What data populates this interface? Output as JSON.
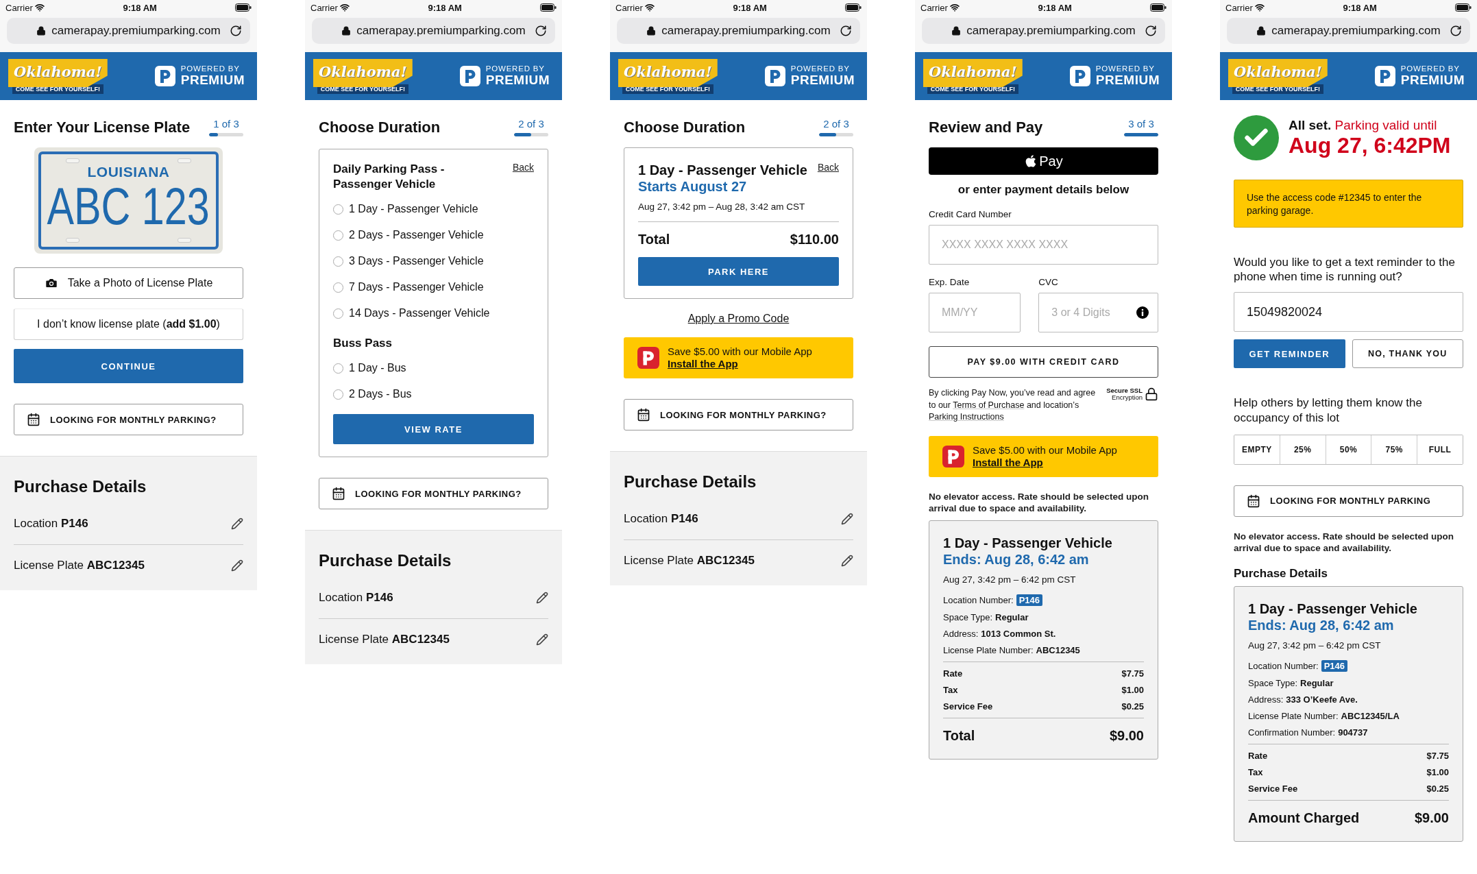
{
  "screens": [
    {
      "status_bar": {
        "carrier": "Carrier",
        "time": "9:18 AM"
      },
      "address_bar": {
        "url": "camerapay.premiumparking.com"
      },
      "header": {
        "logo_wordmark": "Oklahoma!",
        "logo_tagline": "COME SEE FOR YOURSELF!",
        "powered_by": "POWERED BY",
        "brand": "PREMIUM"
      },
      "blocks": [
        {
          "kind": "step_heading",
          "title": "Enter Your License Plate",
          "step": "1 of 3",
          "level": 0.25
        },
        {
          "kind": "plate",
          "state": "LOUISIANA",
          "number": "ABC 123"
        },
        {
          "kind": "photo_button",
          "label": "Take a Photo of License Plate"
        },
        {
          "kind": "text_button",
          "label": "I don’t know license plate (**add $1.00**)"
        },
        {
          "kind": "primary_button",
          "label": "CONTINUE"
        },
        {
          "kind": "monthly_button",
          "label": "LOOKING FOR MONTHLY PARKING?"
        },
        {
          "kind": "purchase_details",
          "title": "Purchase Details",
          "rows": [
            "Location **P146**",
            "License Plate **ABC12345**"
          ]
        }
      ]
    },
    {
      "status_bar": {
        "carrier": "Carrier",
        "time": "9:18 AM"
      },
      "address_bar": {
        "url": "camerapay.premiumparking.com"
      },
      "header": {
        "logo_wordmark": "Oklahoma!",
        "logo_tagline": "COME SEE FOR YOURSELF!",
        "powered_by": "POWERED BY",
        "brand": "PREMIUM"
      },
      "blocks": [
        {
          "kind": "step_heading",
          "title": "Choose Duration",
          "step": "2 of 3",
          "level": 0.5
        },
        {
          "kind": "duration_card",
          "back": "Back",
          "button": "VIEW RATE",
          "groups": [
            {
              "title": "Daily Parking Pass - Passenger Vehicle",
              "options": [
                {
                  "label": "1 Day - Passenger Vehicle",
                  "selected": false
                },
                {
                  "label": "2 Days - Passenger Vehicle",
                  "selected": false
                },
                {
                  "label": "3 Days - Passenger Vehicle",
                  "selected": false
                },
                {
                  "label": "7 Days - Passenger Vehicle",
                  "selected": false
                },
                {
                  "label": "14 Days - Passenger Vehicle",
                  "selected": false
                }
              ]
            },
            {
              "title": "Buss Pass",
              "options": [
                {
                  "label": "1 Day - Bus",
                  "selected": false
                },
                {
                  "label": "2 Days - Bus",
                  "selected": false
                }
              ]
            }
          ]
        },
        {
          "kind": "monthly_button",
          "label": "LOOKING FOR MONTHLY PARKING?"
        },
        {
          "kind": "purchase_details",
          "title": "Purchase Details",
          "rows": [
            "Location **P146**",
            "License Plate **ABC12345**"
          ]
        }
      ]
    },
    {
      "status_bar": {
        "carrier": "Carrier",
        "time": "9:18 AM"
      },
      "address_bar": {
        "url": "camerapay.premiumparking.com"
      },
      "header": {
        "logo_wordmark": "Oklahoma!",
        "logo_tagline": "COME SEE FOR YOURSELF!",
        "powered_by": "POWERED BY",
        "brand": "PREMIUM"
      },
      "blocks": [
        {
          "kind": "step_heading",
          "title": "Choose Duration",
          "step": "2 of 3",
          "level": 0.5
        },
        {
          "kind": "rate_card",
          "title": "1 Day - Passenger Vehicle",
          "back": "Back",
          "subtitle": "Starts August 27",
          "dates": "Aug 27, 3:42 pm – Aug 28, 3:42 am CST",
          "total_label": "Total",
          "total_value": "$110.00",
          "button": "PARK HERE"
        },
        {
          "kind": "link",
          "label": "Apply a Promo Code"
        },
        {
          "kind": "app_promo",
          "text": "Save $5.00 with our Mobile App",
          "link": "Install the App"
        },
        {
          "kind": "monthly_button",
          "label": "LOOKING FOR MONTHLY PARKING?"
        },
        {
          "kind": "purchase_details",
          "title": "Purchase Details",
          "rows": [
            "Location **P146**",
            "License Plate **ABC12345**"
          ]
        }
      ]
    },
    {
      "status_bar": {
        "carrier": "Carrier",
        "time": "9:18 AM"
      },
      "address_bar": {
        "url": "camerapay.premiumparking.com"
      },
      "header": {
        "logo_wordmark": "Oklahoma!",
        "logo_tagline": "COME SEE FOR YOURSELF!",
        "powered_by": "POWERED BY",
        "brand": "PREMIUM"
      },
      "blocks": [
        {
          "kind": "step_heading",
          "title": "Review and Pay",
          "step": "3 of 3",
          "level": 1
        },
        {
          "kind": "apple_pay",
          "label": "Pay"
        },
        {
          "kind": "subheading",
          "text": "or enter payment details below"
        },
        {
          "kind": "field_row",
          "fields": [
            {
              "label": "Credit Card Number",
              "placeholder": "XXXX XXXX XXXX XXXX",
              "info": false
            }
          ]
        },
        {
          "kind": "field_row",
          "fields": [
            {
              "label": "Exp. Date",
              "placeholder": "MM/YY",
              "info": false
            },
            {
              "label": "CVC",
              "placeholder": "3 or 4 Digits",
              "info": true
            }
          ]
        },
        {
          "kind": "outline_button",
          "label": "PAY $9.00 WITH CREDIT CARD"
        },
        {
          "kind": "terms",
          "parts": [
            {
              "text": "By clicking Pay Now, you’ve read and agree to our ",
              "link": false
            },
            {
              "text": "Terms of Purchase",
              "link": true
            },
            {
              "text": " and location’s ",
              "link": false
            },
            {
              "text": "Parking Instructions",
              "link": true
            }
          ],
          "ssl_title": "Secure SSL",
          "ssl_subtitle": "Encryption"
        },
        {
          "kind": "app_promo",
          "text": "Save $5.00 with our Mobile App",
          "link": "Install the App"
        },
        {
          "kind": "note",
          "text": "No elevator access. Rate should be selected upon arrival due to space and availability."
        },
        {
          "kind": "summary_card",
          "title": "1 Day - Passenger Vehicle",
          "highlight": "Ends: Aug 28, 6:42 am",
          "dates": "Aug 27, 3:42 pm – 6:42 pm CST",
          "details": [
            {
              "label": "Location Number:",
              "value": "P146",
              "kind": "badge"
            },
            {
              "label": "Space Type:",
              "value": "Regular",
              "kind": "bold"
            },
            {
              "label": "Address:",
              "value": "1013 Common St.",
              "kind": "bold"
            },
            {
              "label": "License Plate Number:",
              "value": "ABC12345",
              "kind": "bold"
            }
          ],
          "charges": [
            {
              "label": "Rate",
              "value": "$7.75"
            },
            {
              "label": "Tax",
              "value": "$1.00"
            },
            {
              "label": "Service Fee",
              "value": "$0.25"
            }
          ],
          "total_label": "Total",
          "total_value": "$9.00"
        }
      ]
    },
    {
      "status_bar": {
        "carrier": "Carrier",
        "time": "9:18 AM"
      },
      "address_bar": {
        "url": "camerapay.premiumparking.com"
      },
      "header": {
        "logo_wordmark": "Oklahoma!",
        "logo_tagline": "COME SEE FOR YOURSELF!",
        "powered_by": "POWERED BY",
        "brand": "PREMIUM"
      },
      "blocks": [
        {
          "kind": "success",
          "lead": "All set.",
          "status": "Parking valid until",
          "date": "Aug 27, 6:42PM"
        },
        {
          "kind": "notice",
          "text": "Use the access code #12345 to enter the parking garage."
        },
        {
          "kind": "question",
          "text": "Would you like to get a text reminder to the phone when time is running out?"
        },
        {
          "kind": "value_field",
          "value": "15049820024"
        },
        {
          "kind": "button_pair",
          "buttons": [
            {
              "label": "GET REMINDER",
              "kind": "primary"
            },
            {
              "label": "NO, THANK YOU",
              "kind": "outline"
            }
          ]
        },
        {
          "kind": "question",
          "text": "Help others by letting them know the occupancy of this lot"
        },
        {
          "kind": "segmented",
          "options": [
            {
              "label": "EMPTY",
              "selected": false
            },
            {
              "label": "25%",
              "selected": false
            },
            {
              "label": "50%",
              "selected": false
            },
            {
              "label": "75%",
              "selected": false
            },
            {
              "label": "FULL",
              "selected": false
            }
          ]
        },
        {
          "kind": "monthly_button",
          "label": "LOOKING FOR MONTHLY PARKING"
        },
        {
          "kind": "note",
          "text": "No elevator access. Rate should be selected upon arrival due to space and availability."
        },
        {
          "kind": "section_title",
          "text": "Purchase Details"
        },
        {
          "kind": "summary_card",
          "title": "1 Day - Passenger Vehicle",
          "highlight": "Ends: Aug 28, 6:42 am",
          "dates": "Aug 27, 3:42 pm – 6:42 pm CST",
          "details": [
            {
              "label": "Location Number:",
              "value": "P146",
              "kind": "badge"
            },
            {
              "label": "Space Type:",
              "value": "Regular",
              "kind": "bold"
            },
            {
              "label": "Address:",
              "value": "333 O’Keefe Ave.",
              "kind": "bold"
            },
            {
              "label": "License Plate Number:",
              "value": "ABC12345/LA",
              "kind": "bold"
            },
            {
              "label": "Confirmation Number:",
              "value": "904737",
              "kind": "bold"
            }
          ],
          "charges": [
            {
              "label": "Rate",
              "value": "$7.75"
            },
            {
              "label": "Tax",
              "value": "$1.00"
            },
            {
              "label": "Service Fee",
              "value": "$0.25"
            }
          ],
          "total_label": "Amount Charged",
          "total_value": "$9.00"
        }
      ]
    }
  ]
}
